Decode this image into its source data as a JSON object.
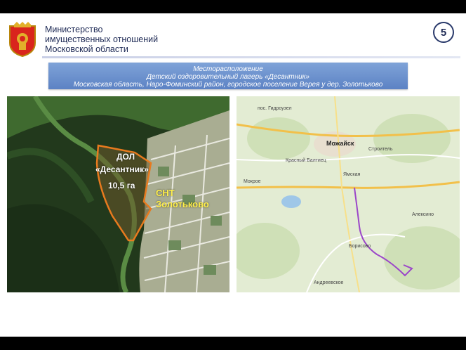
{
  "header": {
    "ministry_line1": "Министерство",
    "ministry_line2": "имущественных отношений",
    "ministry_line3": "Московской области",
    "page_number": "5"
  },
  "banner": {
    "line1": "Месторасположение",
    "line2": "Детский оздоровительный лагерь «Десантник»",
    "line3": "Московская область, Наро-Фоминский район, городское поселение Верея у дер. Золотьково"
  },
  "photo": {
    "label_dol": "ДОЛ",
    "label_name": "«Десантник»",
    "label_area": "10,5 га",
    "label_snt_line1": "СНТ",
    "label_snt_line2": "Золотьково",
    "boundary_color": "#e87a1e",
    "snt_label_color": "#ffef4a"
  },
  "map": {
    "city": "Можайск",
    "towns": [
      "пос. Гидроузел",
      "Красный Балтиец",
      "Строитель",
      "Ямская",
      "Мокрое",
      "Алексино",
      "Борисово",
      "Андреевское"
    ],
    "route_color": "#9b46c9"
  }
}
